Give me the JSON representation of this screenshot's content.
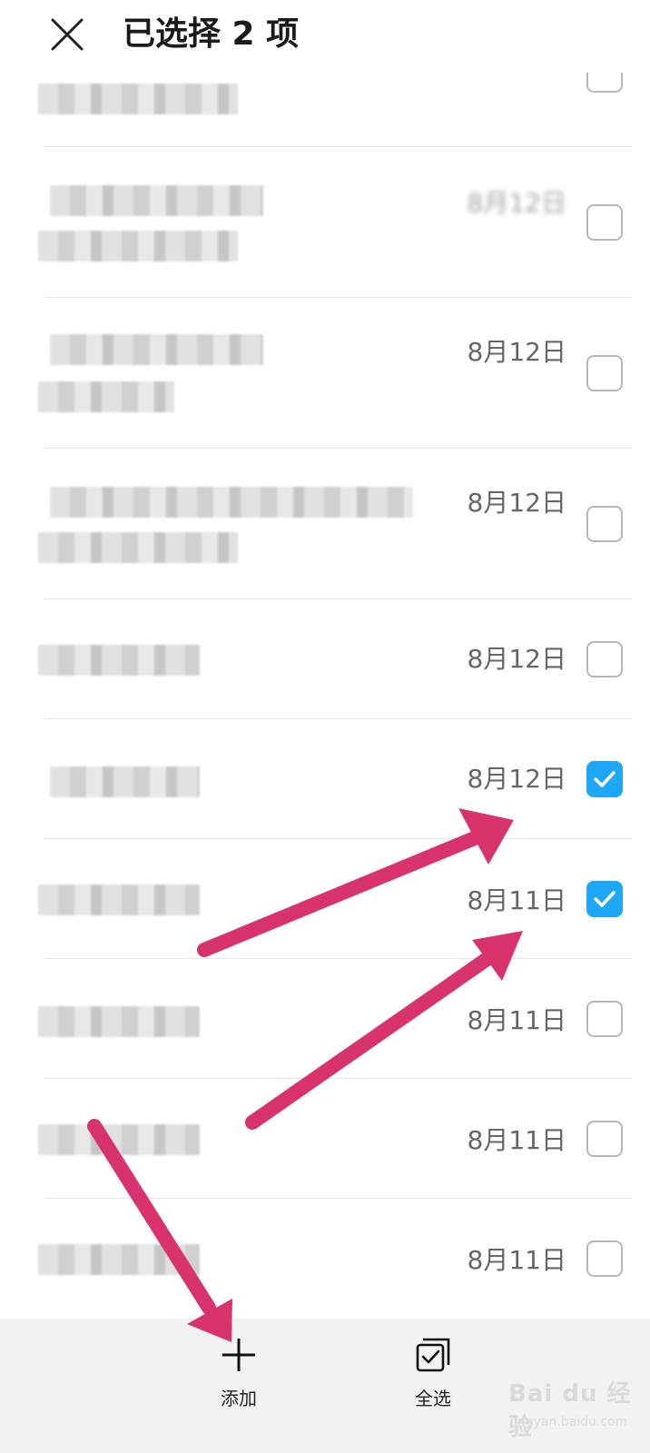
{
  "header": {
    "title": "已选择 2 项"
  },
  "list": {
    "items": [
      {
        "date": "",
        "checked": false
      },
      {
        "date": "8月12日",
        "checked": false
      },
      {
        "date": "8月12日",
        "checked": false
      },
      {
        "date": "8月12日",
        "checked": false
      },
      {
        "date": "8月12日",
        "checked": false
      },
      {
        "date": "8月12日",
        "checked": true
      },
      {
        "date": "8月11日",
        "checked": true
      },
      {
        "date": "8月11日",
        "checked": false
      },
      {
        "date": "8月11日",
        "checked": false
      },
      {
        "date": "8月11日",
        "checked": false
      }
    ]
  },
  "bottom_bar": {
    "add_label": "添加",
    "add_icon": "plus-icon",
    "select_all_label": "全选",
    "select_all_icon": "select-all-icon"
  },
  "colors": {
    "accent": "#1ea7f6",
    "annotation_arrow": "#d9336f"
  },
  "watermark": {
    "brand": "Bai du 经验",
    "url": "jingyan.baidu.com"
  }
}
